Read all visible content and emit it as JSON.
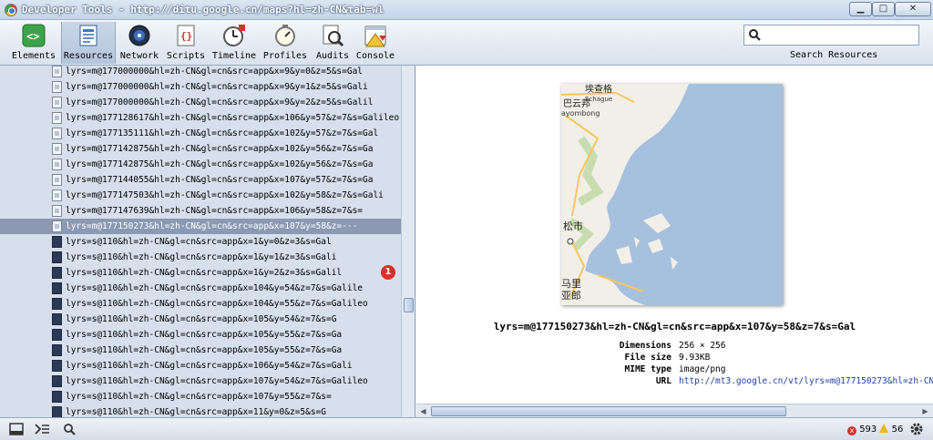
{
  "window": {
    "title": "Developer Tools - http://ditu.google.cn/maps?hl=zh-CN&tab=wl",
    "minimize": "▁",
    "maximize": "□",
    "close": "✕"
  },
  "toolbar": {
    "tabs": [
      {
        "label": "Elements"
      },
      {
        "label": "Resources"
      },
      {
        "label": "Network"
      },
      {
        "label": "Scripts"
      },
      {
        "label": "Timeline"
      },
      {
        "label": "Profiles"
      },
      {
        "label": "Audits"
      },
      {
        "label": "Console"
      }
    ],
    "active_tab": "Resources",
    "search_placeholder": "",
    "search_caption": "Search Resources"
  },
  "resources": {
    "items": [
      "lyrs=m@177000000&hl=zh-CN&gl=cn&src=app&x=9&y=0&z=5&s=Gal",
      "lyrs=m@177000000&hl=zh-CN&gl=cn&src=app&x=9&y=1&z=5&s=Gali",
      "lyrs=m@177000000&hl=zh-CN&gl=cn&src=app&x=9&y=2&z=5&s=Galil",
      "lyrs=m@177128617&hl=zh-CN&gl=cn&src=app&x=106&y=57&z=7&s=Galileo",
      "lyrs=m@177135111&hl=zh-CN&gl=cn&src=app&x=102&y=57&z=7&s=Gal",
      "lyrs=m@177142875&hl=zh-CN&gl=cn&src=app&x=102&y=56&z=7&s=Ga",
      "lyrs=m@177142875&hl=zh-CN&gl=cn&src=app&x=102&y=56&z=7&s=Ga",
      "lyrs=m@177144055&hl=zh-CN&gl=cn&src=app&x=107&y=57&z=7&s=Ga",
      "lyrs=m@177147503&hl=zh-CN&gl=cn&src=app&x=102&y=58&z=7&s=Gali",
      "lyrs=m@177147639&hl=zh-CN&gl=cn&src=app&x=106&y=58&z=7&s=",
      "lyrs=m@177150273&hl=zh-CN&gl=cn&src=app&x=107&y=58&z=---",
      "lyrs=s@110&hl=zh-CN&gl=cn&src=app&x=1&y=0&z=3&s=Gal",
      "lyrs=s@110&hl=zh-CN&gl=cn&src=app&x=1&y=1&z=3&s=Gali",
      "lyrs=s@110&hl=zh-CN&gl=cn&src=app&x=1&y=2&z=3&s=Galil",
      "lyrs=s@110&hl=zh-CN&gl=cn&src=app&x=104&y=54&z=7&s=Galile",
      "lyrs=s@110&hl=zh-CN&gl=cn&src=app&x=104&y=55&z=7&s=Galileo",
      "lyrs=s@110&hl=zh-CN&gl=cn&src=app&x=105&y=54&z=7&s=G",
      "lyrs=s@110&hl=zh-CN&gl=cn&src=app&x=105&y=55&z=7&s=Ga",
      "lyrs=s@110&hl=zh-CN&gl=cn&src=app&x=105&y=55&z=7&s=Ga",
      "lyrs=s@110&hl=zh-CN&gl=cn&src=app&x=106&y=54&z=7&s=Gali",
      "lyrs=s@110&hl=zh-CN&gl=cn&src=app&x=107&y=54&z=7&s=Galileo",
      "lyrs=s@110&hl=zh-CN&gl=cn&src=app&x=107&y=55&z=7&s=",
      "lyrs=s@110&hl=zh-CN&gl=cn&src=app&x=11&y=0&z=5&s=G"
    ],
    "selected_index": 10,
    "error_badge": "1"
  },
  "preview": {
    "map_labels": {
      "l1": "埃查格",
      "l2": "Echague",
      "l3": "巴云邦",
      "l4": "ayombong",
      "l5": "松市",
      "l6": "马里",
      "l7": "亚郎"
    },
    "title": "lyrs=m@177150273&hl=zh-CN&gl=cn&src=app&x=107&y=58&z=7&s=Gal",
    "meta": [
      {
        "key": "Dimensions",
        "value": "256 × 256"
      },
      {
        "key": "File size",
        "value": "9.93KB"
      },
      {
        "key": "MIME type",
        "value": "image/png"
      },
      {
        "key": "URL",
        "value": "http://mt3.google.cn/vt/lyrs=m@177150273&hl=zh-CN"
      }
    ]
  },
  "status": {
    "errors": "593",
    "warnings": "56",
    "error_glyph": "x"
  },
  "colors": {
    "selected_row": "#8b99b2",
    "error_badge": "#d2332b",
    "warning": "#e8b820",
    "map_water": "#a7c0dd",
    "map_land": "#f2efe9"
  }
}
